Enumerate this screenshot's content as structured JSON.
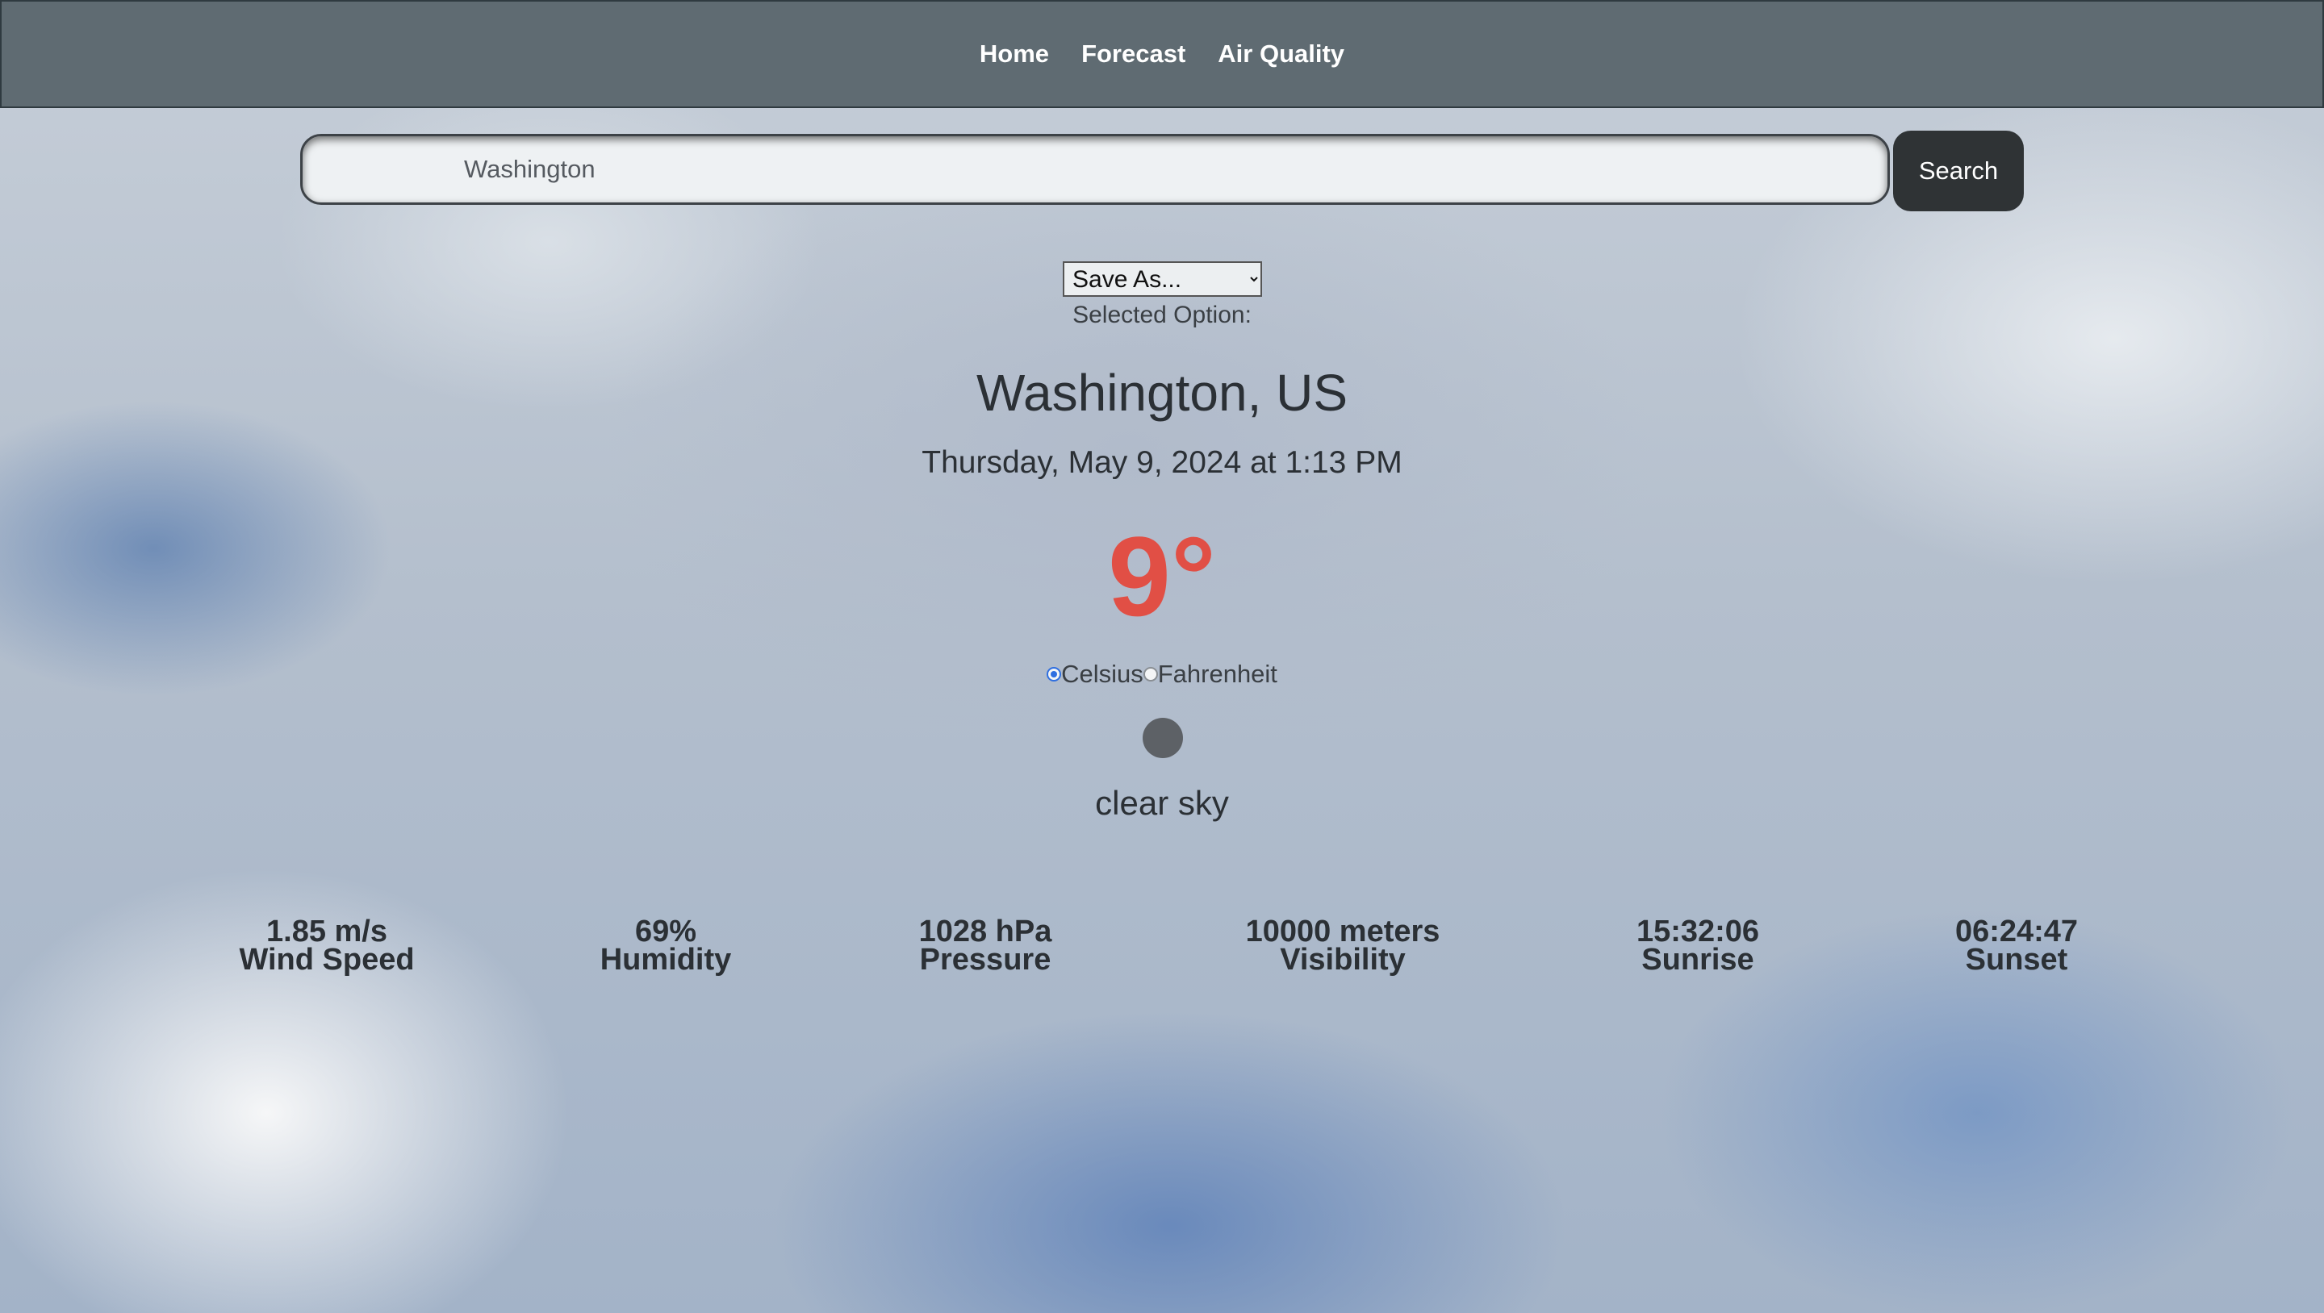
{
  "nav": {
    "home": "Home",
    "forecast": "Forecast",
    "air_quality": "Air Quality"
  },
  "search": {
    "value": "Washington",
    "button_label": "Search"
  },
  "save_select": {
    "selected": "Save As..."
  },
  "selected_option_text": "Selected Option:",
  "location": "Washington, US",
  "datetime": "Thursday, May 9, 2024 at 1:13 PM",
  "temperature": "9°",
  "units": {
    "celsius": "Celsius",
    "fahrenheit": "Fahrenheit",
    "selected": "celsius"
  },
  "weather_icon": "weather-condition-icon",
  "description": "clear sky",
  "stats": {
    "wind": {
      "value": "1.85 m/s",
      "label": "Wind Speed"
    },
    "humidity": {
      "value": "69%",
      "label": "Humidity"
    },
    "pressure": {
      "value": "1028 hPa",
      "label": "Pressure"
    },
    "visibility": {
      "value": "10000 meters",
      "label": "Visibility"
    },
    "sunrise": {
      "value": "15:32:06",
      "label": "Sunrise"
    },
    "sunset": {
      "value": "06:24:47",
      "label": "Sunset"
    }
  },
  "colors": {
    "navbar": "#5f6b72",
    "temperature": "#e14f45",
    "search_button": "#2f3335",
    "radio_accent": "#2f6fe0"
  }
}
